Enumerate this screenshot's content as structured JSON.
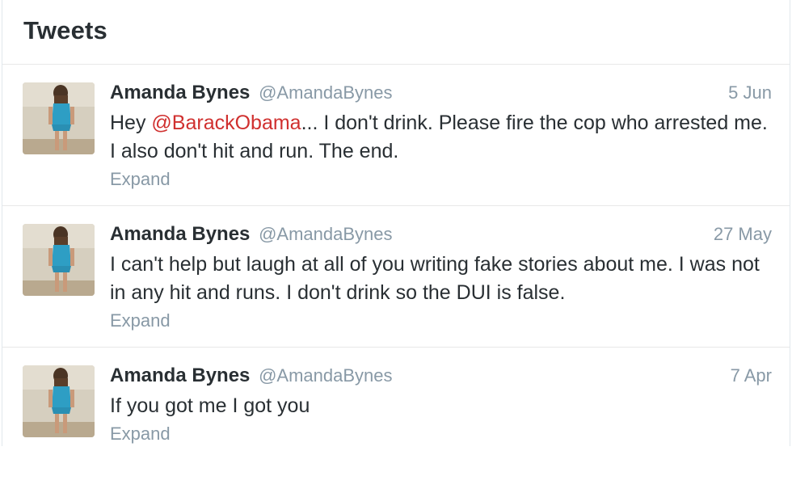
{
  "header": {
    "title": "Tweets"
  },
  "tweets": [
    {
      "fullname": "Amanda Bynes",
      "screen_name": "@AmandaBynes",
      "timestamp": "5 Jun",
      "text_before": "Hey ",
      "mention": "@BarackObama",
      "text_after": "... I don't drink. Please fire the cop who arrested me. I also don't hit and run. The end.",
      "expand_label": "Expand"
    },
    {
      "fullname": "Amanda Bynes",
      "screen_name": "@AmandaBynes",
      "timestamp": "27 May",
      "text": "I can't help but laugh at all of you writing fake stories about me. I was not in any hit and runs. I don't drink so the DUI is false.",
      "expand_label": "Expand"
    },
    {
      "fullname": "Amanda Bynes",
      "screen_name": "@AmandaBynes",
      "timestamp": "7 Apr",
      "text": "If you got me I got you",
      "expand_label": "Expand"
    }
  ],
  "colors": {
    "mention": "#d0302f",
    "secondary_text": "#8899a6",
    "primary_text": "#292f33"
  }
}
